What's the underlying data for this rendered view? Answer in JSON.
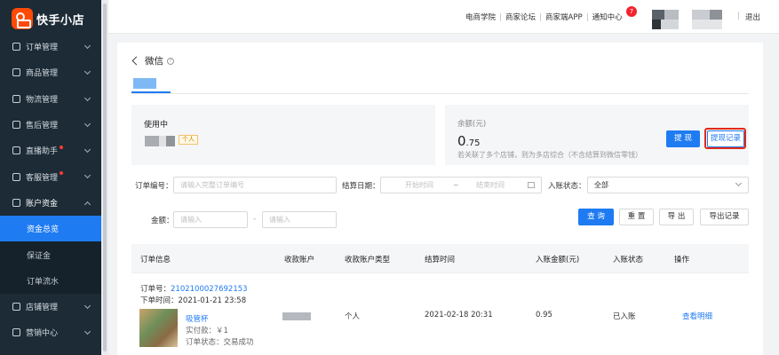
{
  "brand": {
    "name": "快手小店"
  },
  "sidebar": {
    "items": [
      {
        "label": "订单管理",
        "icon": "order-icon"
      },
      {
        "label": "商品管理",
        "icon": "goods-icon"
      },
      {
        "label": "物流管理",
        "icon": "truck-icon"
      },
      {
        "label": "售后管理",
        "icon": "shield-icon"
      },
      {
        "label": "直播助手",
        "icon": "live-icon",
        "dot": true
      },
      {
        "label": "客服管理",
        "icon": "service-icon",
        "dot": true
      },
      {
        "label": "账户资金",
        "icon": "funds-icon",
        "open": true
      },
      {
        "label": "资金总览",
        "sub": true,
        "active": true
      },
      {
        "label": "保证金",
        "sub": true
      },
      {
        "label": "订单流水",
        "sub": true
      },
      {
        "label": "店铺管理",
        "icon": "store-icon"
      },
      {
        "label": "营销中心",
        "icon": "marketing-icon"
      }
    ]
  },
  "topbar": {
    "links": [
      "电商学院",
      "商家论坛",
      "商家端APP",
      "通知中心"
    ],
    "notification_count": "7",
    "logout": "退出"
  },
  "page": {
    "title": "微信",
    "help_icon": "question-icon"
  },
  "status_card": {
    "title": "使用中",
    "tag": "个人"
  },
  "balance_card": {
    "label": "余额(元)",
    "amount_int": "0",
    "amount_dec": ".75",
    "note": "若关联了多个店铺，则为多店综合（不含结算到微信零钱）",
    "withdraw_label": "提 现",
    "record_label": "提现记录"
  },
  "filters": {
    "order_no_label": "订单编号：",
    "order_no_placeholder": "请输入完整订单编号",
    "settle_date_label": "结算日期：",
    "start_placeholder": "开始时间",
    "range_sep": "~",
    "end_placeholder": "结束时间",
    "status_label": "入账状态：",
    "status_value": "全部",
    "amount_label": "金额：",
    "amount_min_placeholder": "请输入",
    "amount_sep": "-",
    "amount_max_placeholder": "请输入",
    "query": "查 询",
    "reset": "重 置",
    "export": "导 出",
    "export_record": "导出记录"
  },
  "table": {
    "headers": [
      "订单信息",
      "收款账户",
      "收款账户类型",
      "结算时间",
      "入账金额(元)",
      "入账状态",
      "操作"
    ],
    "rows": [
      {
        "order_no_label": "订单号：",
        "order_no": "2102100027692153",
        "order_time": "下单时间：2021-01-21 23:58",
        "product_name": "吸管杯",
        "paid": "实付款：￥1",
        "order_status": "订单状态：交易成功",
        "account_type": "个人",
        "settle_time": "2021-02-18 20:31",
        "amount": "0.95",
        "status": "已入账",
        "action": "查看明细"
      }
    ]
  }
}
